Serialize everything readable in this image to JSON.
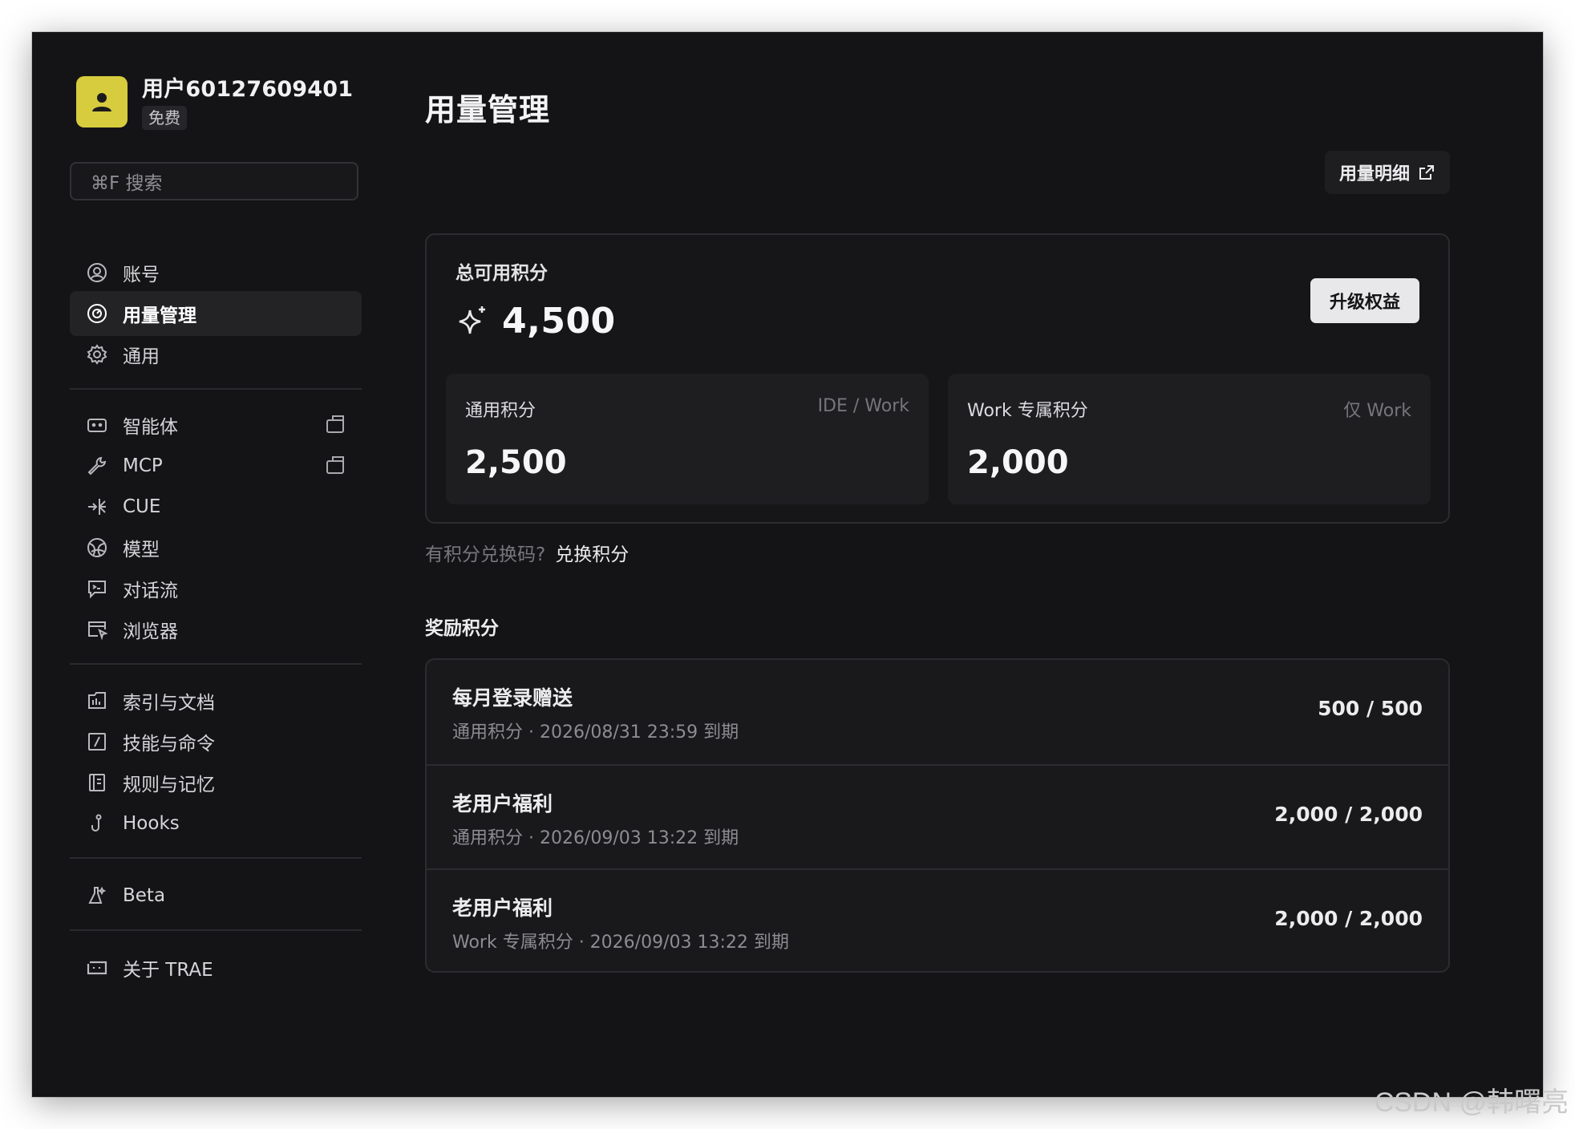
{
  "user": {
    "name": "用户60127609401",
    "plan": "免费",
    "avatar_color": "#d7cc3e"
  },
  "search": {
    "placeholder": "⌘F 搜索"
  },
  "sidebar": {
    "groups": [
      [
        {
          "label": "账号",
          "icon": "account-icon",
          "active": false
        },
        {
          "label": "用量管理",
          "icon": "gauge-icon",
          "active": true
        },
        {
          "label": "通用",
          "icon": "gear-icon",
          "active": false
        }
      ],
      [
        {
          "label": "智能体",
          "icon": "robot-icon",
          "external": true
        },
        {
          "label": "MCP",
          "icon": "wrench-icon",
          "external": true
        },
        {
          "label": "CUE",
          "icon": "cue-icon"
        },
        {
          "label": "模型",
          "icon": "globe-model-icon"
        },
        {
          "label": "对话流",
          "icon": "chat-terminal-icon"
        },
        {
          "label": "浏览器",
          "icon": "browser-icon"
        }
      ],
      [
        {
          "label": "索引与文档",
          "icon": "index-docs-icon"
        },
        {
          "label": "技能与命令",
          "icon": "slash-command-icon"
        },
        {
          "label": "规则与记忆",
          "icon": "rules-book-icon"
        },
        {
          "label": "Hooks",
          "icon": "hook-icon"
        }
      ],
      [
        {
          "label": "Beta",
          "icon": "flask-icon"
        }
      ],
      [
        {
          "label": "关于 TRAE",
          "icon": "trae-logo-icon"
        }
      ]
    ]
  },
  "main": {
    "title": "用量管理",
    "usage_detail_label": "用量明细",
    "total_label": "总可用积分",
    "total_value": "4,500",
    "upgrade_label": "升级权益",
    "general": {
      "label": "通用积分",
      "scope": "IDE / Work",
      "value": "2,500"
    },
    "work": {
      "label": "Work 专属积分",
      "scope": "仅 Work",
      "value": "2,000"
    },
    "redeem_question": "有积分兑换码?",
    "redeem_link": "兑换积分",
    "rewards_title": "奖励积分",
    "rewards": [
      {
        "name": "每月登录赠送",
        "meta": "通用积分 · 2026/08/31 23:59 到期",
        "amount": "500 / 500"
      },
      {
        "name": "老用户福利",
        "meta": "通用积分 · 2026/09/03 13:22 到期",
        "amount": "2,000 / 2,000"
      },
      {
        "name": "老用户福利",
        "meta": "Work 专属积分 · 2026/09/03 13:22 到期",
        "amount": "2,000 / 2,000"
      }
    ]
  },
  "watermark": "CSDN @韩曙亮"
}
